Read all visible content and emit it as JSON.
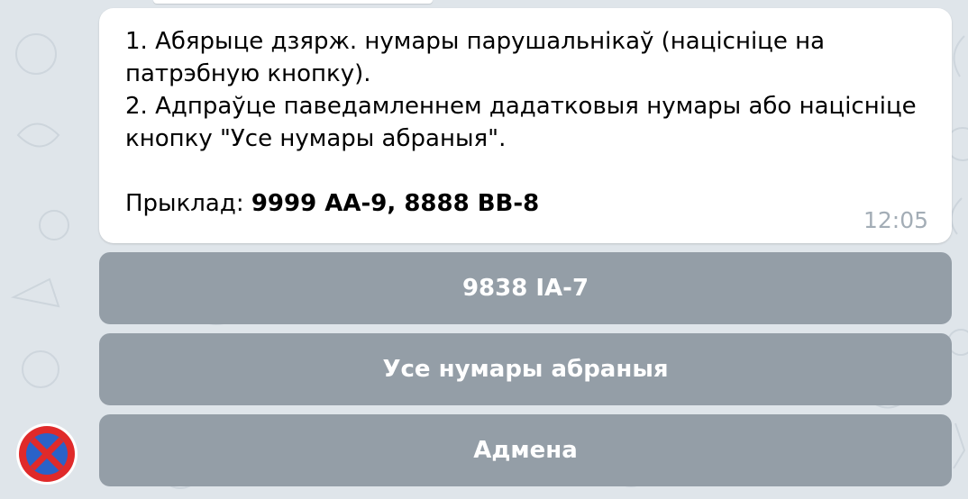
{
  "message": {
    "lines": [
      "1. Абярыце дзярж. нумары парушальнікаў (націсніце на",
      "патрэбную кнопку).",
      "2. Адпраўце паведамленнем дадатковыя нумары або націсніце",
      "кнопку \"Усе нумары абраныя\"."
    ],
    "example_label": "Прыклад: ",
    "example_value": "9999 АА-9, 8888 ВВ-8",
    "time": "12:05"
  },
  "keyboard": {
    "buttons": [
      "9838 IA-7",
      "Усе нумары абраныя",
      "Адмена"
    ]
  },
  "icons": {
    "avatar": "no-stopping-sign-icon"
  },
  "colors": {
    "background": "#dfe5ea",
    "bubble": "#ffffff",
    "button": "#949ea7",
    "time": "#a3adb6",
    "sign_red": "#e02a2a",
    "sign_blue": "#2a62c8"
  }
}
